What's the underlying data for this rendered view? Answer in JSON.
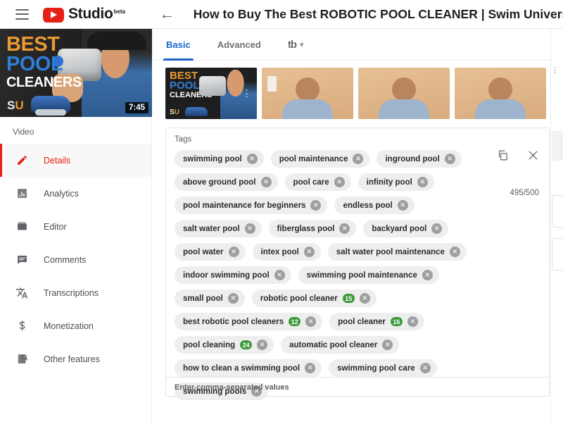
{
  "topbar": {
    "menu_icon": "hamburger-icon",
    "brand": "Studio",
    "brand_sup": "beta",
    "back_icon": "back-arrow-icon",
    "video_title": "How to Buy The Best ROBOTIC POOL CLEANER | Swim University"
  },
  "left": {
    "thumbnail": {
      "line1": "BEST",
      "line2": "POOL",
      "line3": "CLEANERS",
      "watermark_s": "S",
      "watermark_u": "U",
      "duration": "7:45"
    },
    "section_label": "Video",
    "items": [
      {
        "label": "Details",
        "icon": "pencil-icon",
        "active": true
      },
      {
        "label": "Analytics",
        "icon": "bar-chart-icon",
        "active": false
      },
      {
        "label": "Editor",
        "icon": "clapperboard-icon",
        "active": false
      },
      {
        "label": "Comments",
        "icon": "comment-icon",
        "active": false
      },
      {
        "label": "Transcriptions",
        "icon": "translate-icon",
        "active": false
      },
      {
        "label": "Monetization",
        "icon": "dollar-icon",
        "active": false
      },
      {
        "label": "Other features",
        "icon": "magnifier-page-icon",
        "active": false
      }
    ]
  },
  "main": {
    "tabs": [
      {
        "label": "Basic",
        "active": true
      },
      {
        "label": "Advanced",
        "active": false
      }
    ],
    "tubebuddy_tab": {
      "logo_text": "tb",
      "chevron": "∨"
    },
    "thumbnails": [
      {
        "type": "custom",
        "selected": true,
        "menu_icon": "more-vertical-icon"
      },
      {
        "type": "auto",
        "selected": false
      },
      {
        "type": "auto",
        "selected": false
      },
      {
        "type": "auto",
        "selected": false
      }
    ],
    "tags_card": {
      "label": "Tags",
      "copy_icon": "copy-icon",
      "close_icon": "close-icon",
      "counter": "495/500",
      "hint": "Enter comma-separated values",
      "tags": [
        {
          "text": "swimming pool"
        },
        {
          "text": "pool maintenance"
        },
        {
          "text": "inground pool"
        },
        {
          "text": "above ground pool"
        },
        {
          "text": "pool care"
        },
        {
          "text": "infinity pool"
        },
        {
          "text": "pool maintenance for beginners"
        },
        {
          "text": "endless pool"
        },
        {
          "text": "salt water pool"
        },
        {
          "text": "fiberglass pool"
        },
        {
          "text": "backyard pool"
        },
        {
          "text": "pool water"
        },
        {
          "text": "intex pool"
        },
        {
          "text": "salt water pool maintenance"
        },
        {
          "text": "indoor swimming pool"
        },
        {
          "text": "swimming pool maintenance"
        },
        {
          "text": "small pool"
        },
        {
          "text": "robotic pool cleaner",
          "badge": "15"
        },
        {
          "text": "best robotic pool cleaners",
          "badge": "12"
        },
        {
          "text": "pool cleaner",
          "badge": "16"
        },
        {
          "text": "pool cleaning",
          "badge": "24"
        },
        {
          "text": "automatic pool cleaner"
        },
        {
          "text": "how to clean a swimming pool"
        },
        {
          "text": "swimming pool care"
        },
        {
          "text": "swimming pools"
        }
      ],
      "remove_icon": "remove-tag-icon"
    }
  },
  "colors": {
    "brand_red": "#e52117",
    "tab_blue": "#1b66c9",
    "badge_green": "#3b9b3b",
    "chip_bg": "#eeeeee"
  }
}
